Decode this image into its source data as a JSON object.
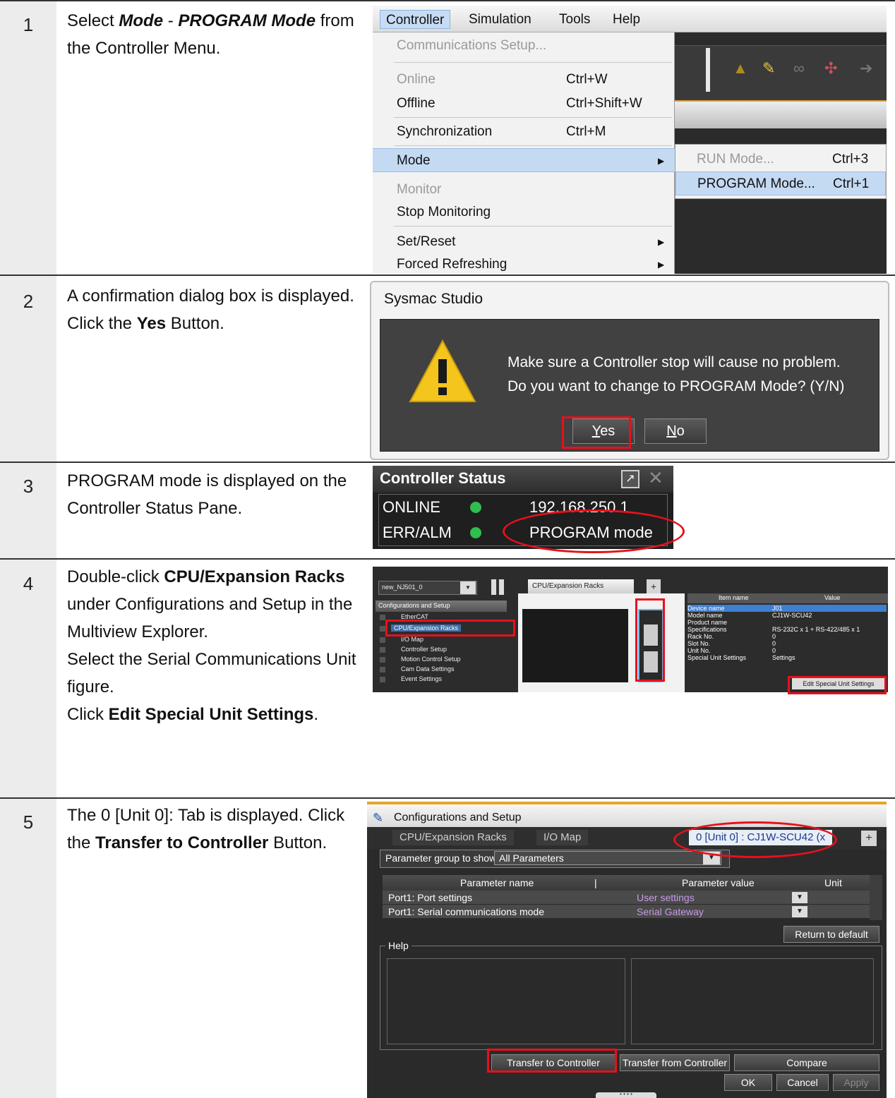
{
  "steps": [
    {
      "num": "1",
      "parts": [
        {
          "t": "Select ",
          "s": "n"
        },
        {
          "t": "Mode",
          "s": "bi"
        },
        {
          "t": " - ",
          "s": "n"
        },
        {
          "t": "PROGRAM Mode",
          "s": "bi"
        },
        {
          "t": " from the Controller Menu.",
          "s": "n"
        }
      ]
    },
    {
      "num": "2",
      "parts": [
        {
          "t": "A confirmation dialog box is displayed. Click the ",
          "s": "n"
        },
        {
          "t": "Yes",
          "s": "b"
        },
        {
          "t": " Button.",
          "s": "n"
        }
      ]
    },
    {
      "num": "3",
      "parts": [
        {
          "t": "PROGRAM mode is displayed on the Controller Status Pane.",
          "s": "n"
        }
      ]
    },
    {
      "num": "4",
      "parts": [
        {
          "t": "Double-click ",
          "s": "n"
        },
        {
          "t": "CPU/Expansion Racks",
          "s": "b"
        },
        {
          "t": " under Configurations and Setup in the Multiview Explorer.",
          "s": "n"
        },
        {
          "t": "\n",
          "s": "br"
        },
        {
          "t": "Select the Serial Communications Unit figure.",
          "s": "n"
        },
        {
          "t": "\n",
          "s": "br"
        },
        {
          "t": "Click ",
          "s": "n"
        },
        {
          "t": "Edit Special Unit Settings",
          "s": "b"
        },
        {
          "t": ".",
          "s": "n"
        }
      ]
    },
    {
      "num": "5",
      "parts": [
        {
          "t": "The 0 [Unit 0]: Tab is displayed. Click the ",
          "s": "n"
        },
        {
          "t": "Transfer to Controller",
          "s": "b"
        },
        {
          "t": " Button.",
          "s": "n"
        }
      ]
    }
  ],
  "shot1": {
    "menubar": [
      "Controller",
      "Simulation",
      "Tools",
      "Help"
    ],
    "menu": [
      {
        "label": "Communications Setup...",
        "shortcut": "",
        "disabled": true
      },
      {
        "label": "Online",
        "shortcut": "Ctrl+W",
        "disabled": true
      },
      {
        "label": "Offline",
        "shortcut": "Ctrl+Shift+W"
      },
      {
        "label": "Synchronization",
        "shortcut": "Ctrl+M"
      },
      {
        "label": "Mode",
        "shortcut": "",
        "submenu": true
      },
      {
        "label": "Monitor",
        "shortcut": "",
        "disabled": true
      },
      {
        "label": "Stop Monitoring",
        "shortcut": ""
      },
      {
        "label": "Set/Reset",
        "shortcut": "",
        "submenu": true
      },
      {
        "label": "Forced Refreshing",
        "shortcut": "",
        "submenu": true
      }
    ],
    "submenu": [
      {
        "label": "RUN Mode...",
        "shortcut": "Ctrl+3",
        "disabled": true
      },
      {
        "label": "PROGRAM Mode...",
        "shortcut": "Ctrl+1"
      }
    ]
  },
  "shot2": {
    "title": "Sysmac Studio",
    "line1": "Make sure a Controller stop will cause no problem.",
    "line2": "Do you want to change to PROGRAM Mode? (Y/N)",
    "yes_mnemonic": "Y",
    "yes_rest": "es",
    "no_mnemonic": "N",
    "no_rest": "o"
  },
  "shot3": {
    "title": "Controller Status",
    "row1_key": "ONLINE",
    "row1_val": "192.168.250.1",
    "row2_key": "ERR/ALM",
    "row2_val": "PROGRAM mode",
    "status_color": "#2fbe4f"
  },
  "shot4": {
    "project": "new_NJ501_0",
    "section": "Configurations and Setup",
    "tree": [
      "EtherCAT",
      "CPU/Expansion Racks",
      "I/O Map",
      "Controller Setup",
      "Motion Control Setup",
      "Cam Data Settings",
      "Event Settings"
    ],
    "tab": "CPU/Expansion Racks",
    "col_item": "Item name",
    "col_value": "Value",
    "props": [
      {
        "k": "Device name",
        "v": "J01"
      },
      {
        "k": "Model name",
        "v": "CJ1W-SCU42"
      },
      {
        "k": "Product name",
        "v": ""
      },
      {
        "k": "Specifications",
        "v": "RS-232C x 1 + RS-422/485 x 1"
      },
      {
        "k": "Rack No.",
        "v": "0"
      },
      {
        "k": "Slot No.",
        "v": "0"
      },
      {
        "k": "Unit No.",
        "v": "0"
      },
      {
        "k": "Special Unit Settings",
        "v": "Settings"
      }
    ],
    "edit_button": "Edit Special Unit Settings"
  },
  "shot5": {
    "title": "Configurations and Setup",
    "tabs": [
      "CPU/Expansion Racks",
      "I/O Map",
      "0 [Unit 0] : CJ1W-SCU42 (x"
    ],
    "param_group_label": "Parameter group to show:",
    "param_group_value": "All Parameters",
    "col_name": "Parameter name",
    "col_value": "Parameter value",
    "col_unit": "Unit",
    "rows": [
      {
        "name": "Port1: Port settings",
        "value": "User settings"
      },
      {
        "name": "Port1: Serial communications mode",
        "value": "Serial Gateway"
      }
    ],
    "return_default": "Return to default",
    "help": "Help",
    "transfer_to": "Transfer to Controller",
    "transfer_from": "Transfer from Controller",
    "compare": "Compare",
    "ok": "OK",
    "cancel": "Cancel",
    "apply": "Apply"
  }
}
